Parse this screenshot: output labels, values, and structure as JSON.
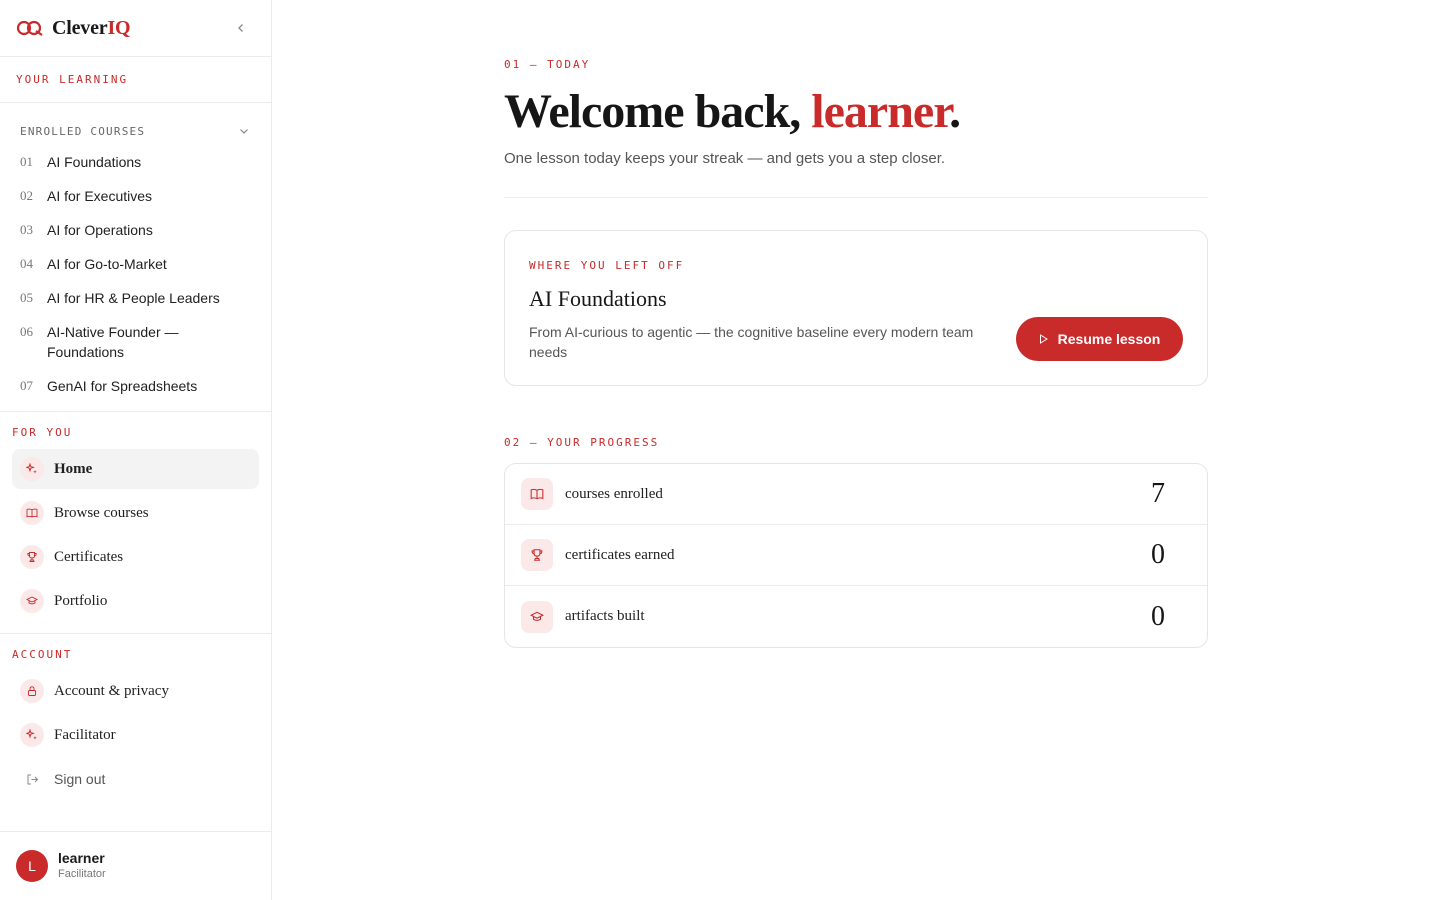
{
  "brand": {
    "name_prefix": "Clever",
    "name_suffix": "IQ",
    "logo_icon": "cleveriq-logo-icon",
    "accent_color": "#c92a2a"
  },
  "sidebar": {
    "collapse_icon": "chevron-left-icon",
    "your_learning_label": "YOUR LEARNING",
    "enrolled_label": "ENROLLED COURSES",
    "courses": [
      {
        "num": "01",
        "name": "AI Foundations"
      },
      {
        "num": "02",
        "name": "AI for Executives"
      },
      {
        "num": "03",
        "name": "AI for Operations"
      },
      {
        "num": "04",
        "name": "AI for Go-to-Market"
      },
      {
        "num": "05",
        "name": "AI for HR & People Leaders"
      },
      {
        "num": "06",
        "name": "AI-Native Founder — Foundations"
      },
      {
        "num": "07",
        "name": "GenAI for Spreadsheets"
      }
    ],
    "for_you_label": "FOR YOU",
    "for_you_items": [
      {
        "label": "Home",
        "icon": "sparkle-icon",
        "active": true
      },
      {
        "label": "Browse courses",
        "icon": "book-icon"
      },
      {
        "label": "Certificates",
        "icon": "trophy-icon"
      },
      {
        "label": "Portfolio",
        "icon": "graduation-cap-icon"
      }
    ],
    "account_label": "ACCOUNT",
    "account_items": [
      {
        "label": "Account & privacy",
        "icon": "lock-icon"
      },
      {
        "label": "Facilitator",
        "icon": "sparkle-icon"
      }
    ],
    "signout_label": "Sign out",
    "user": {
      "initial": "L",
      "name": "learner",
      "role": "Facilitator"
    }
  },
  "main": {
    "eyebrow": "01 — TODAY",
    "welcome_prefix": "Welcome back, ",
    "welcome_name": "learner",
    "welcome_suffix": ".",
    "subtitle": "One lesson today keeps your streak — and gets you a step closer.",
    "resume_card": {
      "eyebrow": "WHERE YOU LEFT OFF",
      "title": "AI Foundations",
      "description": "From AI-curious to agentic — the cognitive baseline every modern team needs",
      "button_label": "Resume lesson"
    },
    "progress_eyebrow": "02 — YOUR PROGRESS",
    "stats": [
      {
        "label": "courses enrolled",
        "value": "7",
        "icon": "book-icon"
      },
      {
        "label": "certificates earned",
        "value": "0",
        "icon": "trophy-icon"
      },
      {
        "label": "artifacts built",
        "value": "0",
        "icon": "graduation-cap-icon"
      }
    ]
  }
}
